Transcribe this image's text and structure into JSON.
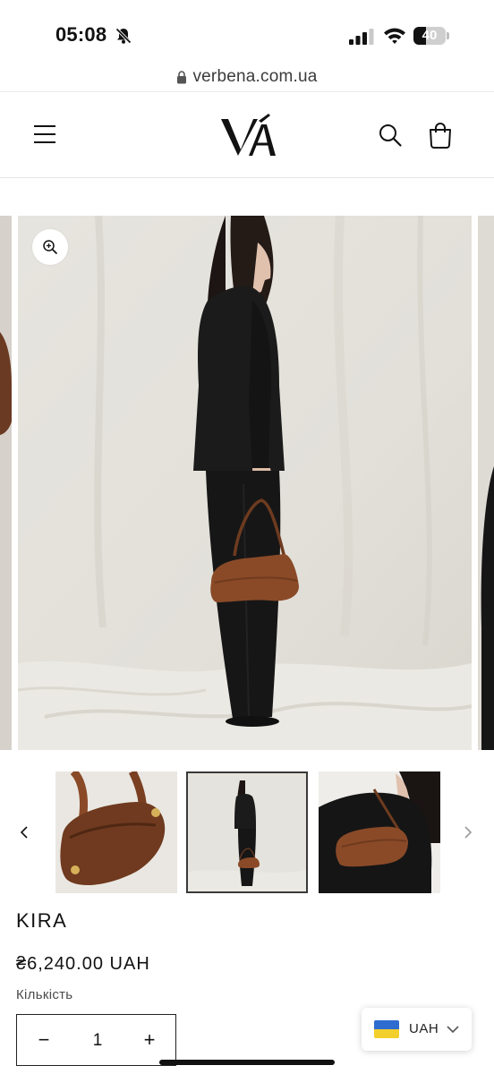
{
  "status_bar": {
    "time": "05:08",
    "battery_level": 40,
    "battery_text": "40"
  },
  "browser": {
    "url": "verbena.com.ua"
  },
  "header": {
    "icons": {
      "menu": "hamburger-icon",
      "search": "search-icon",
      "cart": "cart-icon"
    }
  },
  "gallery": {
    "zoom_icon": "zoom-in-icon",
    "thumbnail_count": 3,
    "selected_thumbnail": 2
  },
  "product": {
    "title": "KIRA",
    "price": "₴6,240.00 UAH",
    "quantity_label": "Кількість",
    "quantity_value": "1",
    "minus_label": "−",
    "plus_label": "+"
  },
  "currency_selector": {
    "label": "UAH",
    "flag_colors": [
      "#2e6ccf",
      "#f2cf2b"
    ]
  },
  "colors": {
    "bag_brown": "#8a4a28",
    "backdrop": "#e4e2dc",
    "suit_black": "#1b1b1b"
  }
}
